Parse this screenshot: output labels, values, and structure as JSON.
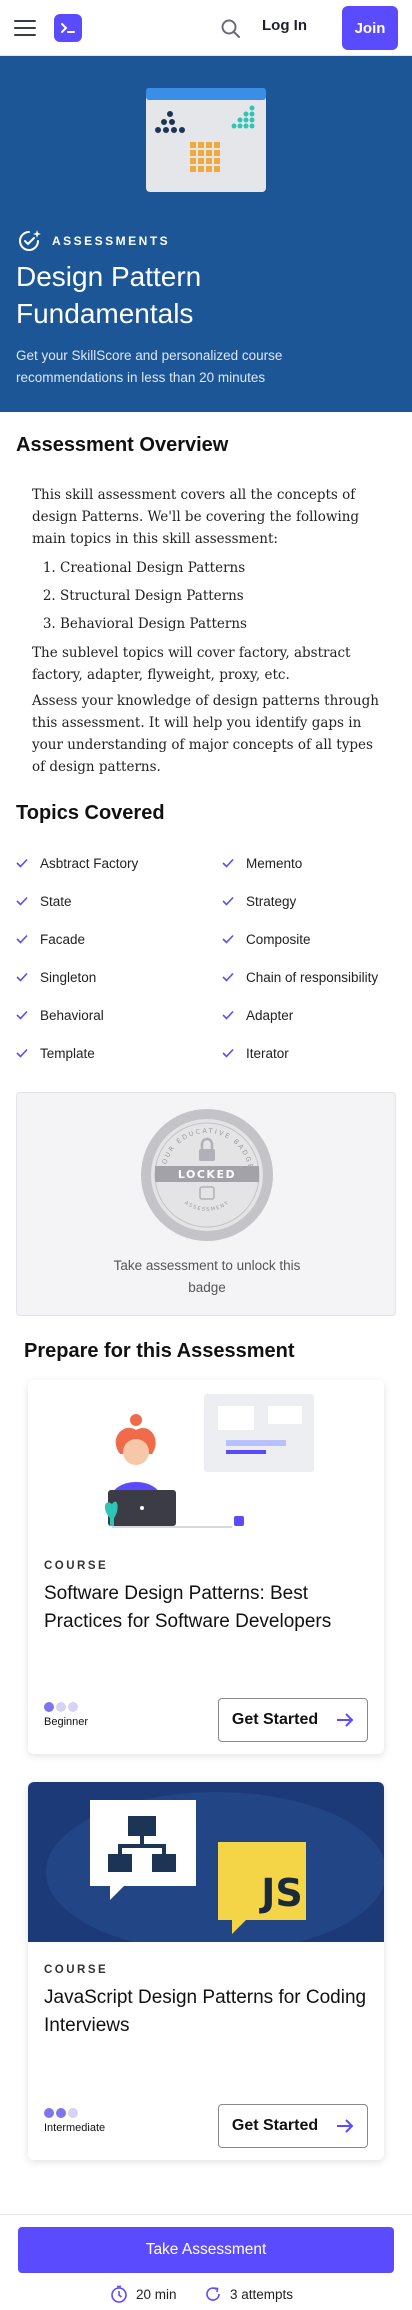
{
  "colors": {
    "brand": "#5b4bff",
    "hero_bg": "#1c5696",
    "check": "#5b4bff"
  },
  "header": {
    "menu_icon": "hamburger-icon",
    "logo_icon": "terminal-logo-icon",
    "search_icon": "search-icon",
    "login_label": "Log In",
    "join_label": "Join"
  },
  "hero": {
    "eyebrow": "ASSESSMENTS",
    "title": "Design Pattern Fundamentals",
    "subtitle": "Get your SkillScore and personalized course recommendations in less than 20 minutes"
  },
  "overview": {
    "heading": "Assessment Overview",
    "intro": "This skill assessment covers all the concepts of design Patterns. We'll be covering the following main topics in this skill assessment:",
    "items": [
      "Creational Design Patterns",
      "Structural Design Patterns",
      "Behavioral Design Patterns"
    ],
    "para2": "The sublevel topics will cover factory, abstract factory, adapter, flyweight, proxy, etc.",
    "para3": "Assess your knowledge of design patterns through this assessment. It will help you identify gaps in your understanding of major concepts of all types of design patterns."
  },
  "topics": {
    "heading": "Topics Covered",
    "items": [
      "Asbtract Factory",
      "Memento",
      "State",
      "Strategy",
      "Facade",
      "Composite",
      "Singleton",
      "Chain of responsibility",
      "Behavioral",
      "Adapter",
      "Template",
      "Iterator"
    ]
  },
  "badge": {
    "ring_top_text": "YOUR EDUCATIVE BADGE",
    "ring_bottom_text": "ASSESSMENT",
    "status": "LOCKED",
    "caption": "Take assessment to unlock this badge"
  },
  "prepare": {
    "heading": "Prepare for this Assessment",
    "courses": [
      {
        "tag": "COURSE",
        "title": "Software Design Patterns: Best Practices for Software Developers",
        "level": "Beginner",
        "level_value": 1,
        "button": "Get Started"
      },
      {
        "tag": "COURSE",
        "title": "JavaScript Design Patterns for Coding Interviews",
        "level": "Intermediate",
        "level_value": 2,
        "button": "Get Started",
        "image_text": "JS"
      }
    ]
  },
  "footer": {
    "take_label": "Take Assessment",
    "duration": "20 min",
    "attempts": "3 attempts"
  }
}
